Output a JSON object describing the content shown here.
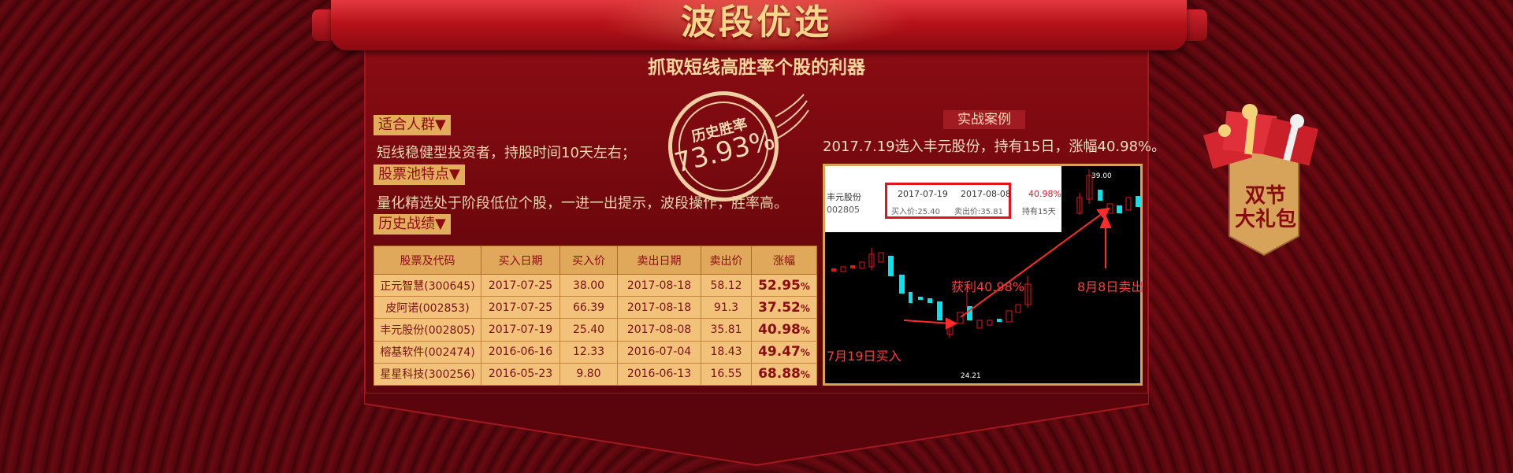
{
  "banner": {
    "title": "波段优选",
    "subtitle": "抓取短线高胜率个股的利器"
  },
  "sections": {
    "audience_tag": "适合人群▼",
    "audience_text": "短线稳健型投资者，持股时间10天左右；",
    "pool_tag": "股票池特点▼",
    "pool_text": "量化精选处于阶段低位个股，一进一出提示，波段操作，胜率高。",
    "history_tag": "历史战绩▼"
  },
  "stamp": {
    "label": "历史胜率",
    "value": "73.93%"
  },
  "table": {
    "headers": [
      "股票及代码",
      "买入日期",
      "买入价",
      "卖出日期",
      "卖出价",
      "涨幅"
    ],
    "rows": [
      [
        "正元智慧(300645)",
        "2017-07-25",
        "38.00",
        "2017-08-18",
        "58.12",
        "52.95"
      ],
      [
        "皮阿诺(002853)",
        "2017-07-25",
        "66.39",
        "2017-08-18",
        "91.3",
        "37.52"
      ],
      [
        "丰元股份(002805)",
        "2017-07-19",
        "25.40",
        "2017-08-08",
        "35.81",
        "40.98"
      ],
      [
        "榕基软件(002474)",
        "2016-06-16",
        "12.33",
        "2016-07-04",
        "18.43",
        "49.47"
      ],
      [
        "星星科技(300256)",
        "2016-05-23",
        "9.80",
        "2016-06-13",
        "16.55",
        "68.88"
      ]
    ],
    "pct_sign": "%"
  },
  "case": {
    "tag": "实战案例",
    "desc": "2017.7.19选入丰元股份，持有15日，涨幅40.98%。",
    "chart": {
      "stock_name": "丰元股份",
      "stock_code": "002805",
      "buy_date": "2017-07-19",
      "sell_date": "2017-08-08",
      "buy_price": "买入价:25.40",
      "sell_price": "卖出价:35.81",
      "change": "40.98%",
      "hold": "持有15天",
      "profit_label": "获利40.98%",
      "buy_label": "7月19日买入",
      "sell_label": "8月8日卖出",
      "high": "39.00",
      "low": "24.21"
    }
  },
  "gift": {
    "line1": "双节",
    "line2": "大礼包"
  },
  "colors": {
    "gold": "#f7d58a",
    "panel_red": "#8a0c13",
    "table_gold": "#f2c27a",
    "rise": "#e4141e",
    "fall": "#00e5f0"
  }
}
